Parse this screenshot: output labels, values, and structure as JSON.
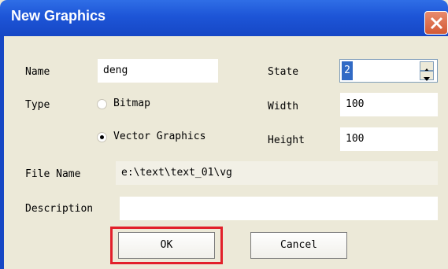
{
  "window": {
    "title": "New Graphics"
  },
  "form": {
    "name_label": "Name",
    "name_value": "deng",
    "state_label": "State",
    "state_value": "2",
    "type_label": "Type",
    "type_options": [
      {
        "label": "Bitmap",
        "selected": false
      },
      {
        "label": "Vector Graphics",
        "selected": true
      }
    ],
    "width_label": "Width",
    "width_value": "100",
    "height_label": "Height",
    "height_value": "100",
    "filename_label": "File Name",
    "filename_value": "e:\\text\\text_01\\vg",
    "description_label": "Description",
    "description_value": ""
  },
  "buttons": {
    "ok": "OK",
    "cancel": "Cancel"
  },
  "colors": {
    "titlebar": "#1d55d7",
    "dialog_bg": "#ece9d8",
    "highlight": "#e2202a"
  }
}
